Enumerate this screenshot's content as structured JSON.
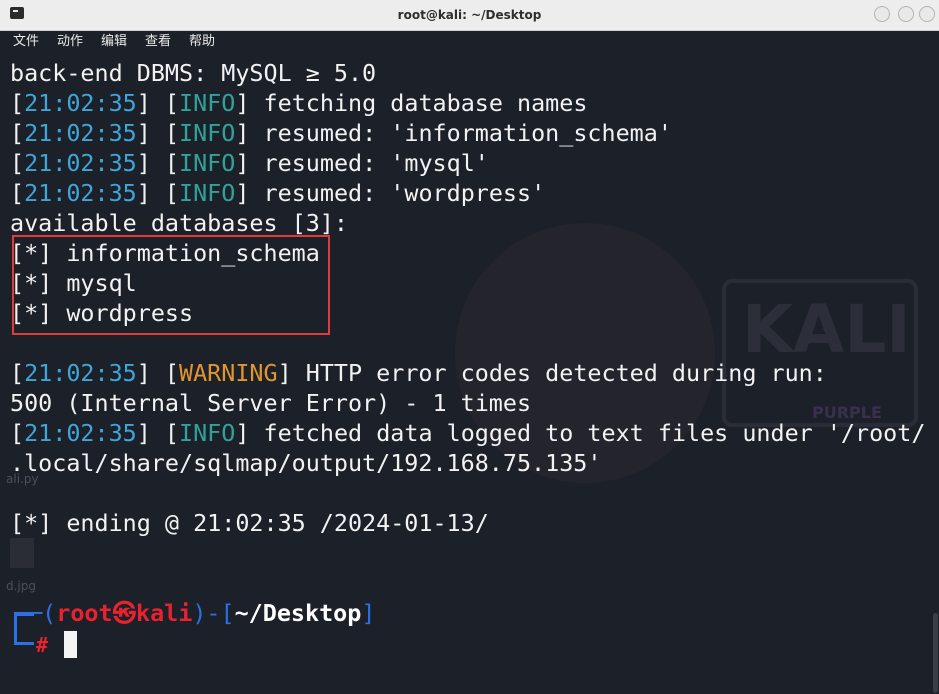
{
  "window": {
    "title": "root@kali: ~/Desktop",
    "icon": "terminal-icon"
  },
  "menu": {
    "items": [
      "文件",
      "动作",
      "编辑",
      "查看",
      "帮助"
    ]
  },
  "watermark": {
    "logo_text": "KALI",
    "logo_sub": "PURPLE"
  },
  "desktop_labels": {
    "file1": "ali.py",
    "file2": "d.jpg"
  },
  "output": {
    "l0": "back-end DBMS: MySQL ≥ 5.0",
    "l1": {
      "ts": "21:02:35",
      "level": "INFO",
      "msg": " fetching database names"
    },
    "l2": {
      "ts": "21:02:35",
      "level": "INFO",
      "msg": " resumed: 'information_schema'"
    },
    "l3": {
      "ts": "21:02:35",
      "level": "INFO",
      "msg": " resumed: 'mysql'"
    },
    "l4": {
      "ts": "21:02:35",
      "level": "INFO",
      "msg": " resumed: 'wordpress'"
    },
    "l5": "available databases [3]:",
    "l6": "[*] information_schema",
    "l7": "[*] mysql",
    "l8": "[*] wordpress",
    "l9": {
      "ts": "21:02:35",
      "level": "WARNING",
      "msg": " HTTP error codes detected during run:"
    },
    "l10": "500 (Internal Server Error) - 1 times",
    "l11": {
      "ts": "21:02:35",
      "level": "INFO",
      "msg": " fetched data logged to text files under '/root/"
    },
    "l12": ".local/share/sqlmap/output/192.168.75.135'",
    "l13": "[*] ending @ 21:02:35 /2024-01-13/"
  },
  "prompt": {
    "user": "root",
    "skull": "㉿",
    "host": "kali",
    "dir": "~/Desktop",
    "symbol": "#"
  },
  "colors": {
    "timestamp": "#3ea6d9",
    "info": "#2fa39b",
    "warning": "#e1952f",
    "prompt_user": "#e8222e",
    "prompt_frame": "#2d6fe6",
    "highlight_box": "#e03b3b"
  }
}
